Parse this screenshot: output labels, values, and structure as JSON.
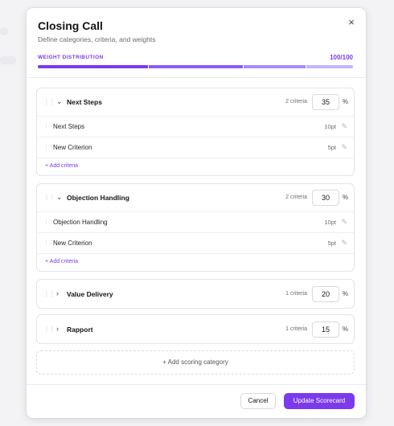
{
  "modal": {
    "title": "Closing Call",
    "subtitle": "Define categories, criteria, and weights",
    "close_icon": "×"
  },
  "weight": {
    "label": "WEIGHT DISTRIBUTION",
    "value": "100/100",
    "segments": [
      {
        "weight": 35,
        "color": "#7c3aed"
      },
      {
        "weight": 30,
        "color": "#8b5cf6"
      },
      {
        "weight": 20,
        "color": "#a78bfa"
      },
      {
        "weight": 15,
        "color": "#c4b5fd"
      }
    ]
  },
  "categories": [
    {
      "name": "Next Steps",
      "expanded": true,
      "criteria_count": "2 criteria",
      "weight": "35",
      "pct": "%",
      "criteria": [
        {
          "name": "Next Steps",
          "points": "10pt"
        },
        {
          "name": "New Criterion",
          "points": "5pt"
        }
      ],
      "add_label": "+  Add criteria"
    },
    {
      "name": "Objection Handling",
      "expanded": true,
      "criteria_count": "2 criteria",
      "weight": "30",
      "pct": "%",
      "criteria": [
        {
          "name": "Objection Handling",
          "points": "10pt"
        },
        {
          "name": "New Criterion",
          "points": "5pt"
        }
      ],
      "add_label": "+  Add criteria"
    },
    {
      "name": "Value Delivery",
      "expanded": false,
      "criteria_count": "1 criteria",
      "weight": "20",
      "pct": "%"
    },
    {
      "name": "Rapport",
      "expanded": false,
      "criteria_count": "1 criteria",
      "weight": "15",
      "pct": "%"
    }
  ],
  "add_category_label": "+  Add scoring category",
  "footer": {
    "cancel_label": "Cancel",
    "update_label": "Update Scorecard"
  },
  "icons": {
    "drag": "drag-handle-icon",
    "chevron_down": "chevron-down-icon",
    "chevron_right": "chevron-right-icon",
    "edit": "pencil-icon",
    "plus": "plus-icon",
    "close": "close-icon"
  },
  "colors": {
    "accent": "#7c3aed"
  }
}
